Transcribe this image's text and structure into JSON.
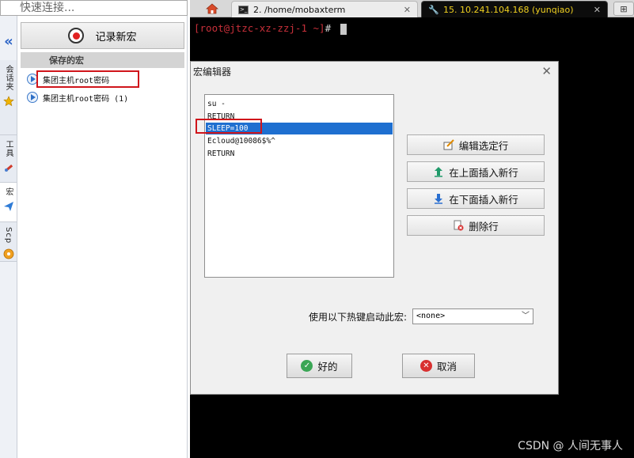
{
  "quick_connect": {
    "placeholder": "快速连接..."
  },
  "side_tabs": [
    {
      "label": "会话夹",
      "icon": "star-icon"
    },
    {
      "label": "工具",
      "icon": "tools-icon"
    },
    {
      "label": "宏",
      "icon": "paper-plane-icon"
    },
    {
      "label": "Scp",
      "icon": "sftp-icon"
    }
  ],
  "macro_panel": {
    "record_label": "记录新宏",
    "saved_header": "保存的宏",
    "items": [
      "集团主机root密码",
      "集团主机root密码 (1)"
    ]
  },
  "tabs": [
    {
      "label": "2. /home/mobaxterm",
      "icon": "terminal-icon"
    },
    {
      "label": "15. 10.241.104.168 (yunqiao)",
      "icon": "key-icon"
    }
  ],
  "terminal": {
    "prompt": "[root@jtzc-xz-zzj-1 ~]",
    "prompt_symbol": "#"
  },
  "dialog": {
    "title": "宏编辑器",
    "lines": [
      "su -",
      "RETURN",
      "SLEEP=100",
      "Ecloud@10086$%^",
      "RETURN"
    ],
    "selected_line": 2,
    "actions": {
      "edit": "编辑选定行",
      "insert_above": "在上面插入新行",
      "insert_below": "在下面插入新行",
      "delete": "删除行"
    },
    "hotkey_label": "使用以下热键启动此宏:",
    "hotkey_value": "<none>",
    "ok": "好的",
    "cancel": "取消"
  },
  "watermark": "CSDN @ 人间无事人",
  "colors": {
    "terminal_bg": "#000000",
    "prompt": "#c8303a",
    "selection": "#1e6fd0",
    "highlight_box": "#d0151b"
  }
}
